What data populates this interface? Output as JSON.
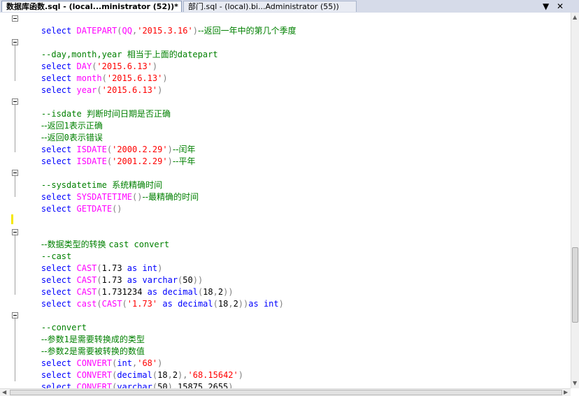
{
  "tabs": [
    {
      "label": "数据库函数.sql - (local...ministrator (52))*",
      "active": true
    },
    {
      "label": "部门.sql - (local).bi...Administrator (55))",
      "active": false
    }
  ],
  "tab_controls": {
    "dropdown": "▼",
    "close": "✕"
  },
  "code": {
    "l1": {
      "a": "select",
      "b": "DATEPART",
      "c": "(",
      "d": "QQ",
      "e": ",",
      "f": "'2015.3.16'",
      "g": ")",
      "h": "--返回一年中的第几个季度"
    },
    "l3": {
      "a": "--day,month,year ",
      "b": "相当于上面的",
      "c": "datepart"
    },
    "l4": {
      "a": "select",
      "b": "DAY",
      "c": "(",
      "d": "'2015.6.13'",
      "e": ")"
    },
    "l5": {
      "a": "select",
      "b": "month",
      "c": "(",
      "d": "'2015.6.13'",
      "e": ")"
    },
    "l6": {
      "a": "select",
      "b": "year",
      "c": "(",
      "d": "'2015.6.13'",
      "e": ")"
    },
    "l8": {
      "a": "--isdate ",
      "b": "判断时间日期是否正确"
    },
    "l9": {
      "a": "--返回",
      "b": "1",
      "c": "表示正确"
    },
    "l10": {
      "a": "--返回",
      "b": "0",
      "c": "表示错误"
    },
    "l11": {
      "a": "select",
      "b": "ISDATE",
      "c": "(",
      "d": "'2000.2.29'",
      "e": ")",
      "f": "--闰年"
    },
    "l12": {
      "a": "select",
      "b": "ISDATE",
      "c": "(",
      "d": "'2001.2.29'",
      "e": ")",
      "f": "--平年"
    },
    "l14": {
      "a": "--sysdatetime ",
      "b": "系统精确时间"
    },
    "l15": {
      "a": "select",
      "b": "SYSDATETIME",
      "c": "()",
      "d": "--最精确的时间"
    },
    "l16": {
      "a": "select",
      "b": "GETDATE",
      "c": "()"
    },
    "l19": {
      "a": "--数据类型的转换 ",
      "b": "cast convert"
    },
    "l20": {
      "a": "--cast"
    },
    "l21": {
      "a": "select",
      "b": "CAST",
      "c": "(",
      "d": "1.73",
      "e": "as",
      "f": "int",
      "g": ")"
    },
    "l22": {
      "a": "select",
      "b": "CAST",
      "c": "(",
      "d": "1.73",
      "e": "as",
      "f": "varchar",
      "g": "(",
      "h": "50",
      "i": "))"
    },
    "l23": {
      "a": "select",
      "b": "CAST",
      "c": "(",
      "d": "1.731234",
      "e": "as",
      "f": "decimal",
      "g": "(",
      "h": "18",
      "i": ",",
      "j": "2",
      "k": "))"
    },
    "l24": {
      "a": "select",
      "b": "cast",
      "c": "(",
      "d": "CAST",
      "e": "(",
      "f": "'1.73'",
      "g": "as",
      "h": "decimal",
      "i": "(",
      "j": "18",
      "k": ",",
      "l": "2",
      "m": "))",
      "n": "as",
      "o": "int",
      "p": ")"
    },
    "l26": {
      "a": "--convert"
    },
    "l27": {
      "a": "--参数",
      "b": "1",
      "c": "是需要转换成的类型"
    },
    "l28": {
      "a": "--参数",
      "b": "2",
      "c": "是需要被转换的数值"
    },
    "l29": {
      "a": "select",
      "b": "CONVERT",
      "c": "(",
      "d": "int",
      "e": ",",
      "f": "'68'",
      "g": ")"
    },
    "l30": {
      "a": "select",
      "b": "CONVERT",
      "c": "(",
      "d": "decimal",
      "e": "(",
      "f": "18",
      "g": ",",
      "h": "2",
      "i": "),",
      "j": "'68.15642'",
      "k": ")"
    },
    "l31": {
      "a": "select",
      "b": "CONVERT",
      "c": "(",
      "d": "varchar",
      "e": "(",
      "f": "50",
      "g": "),",
      "h": "15875.2655",
      "i": ")"
    }
  },
  "colors": {
    "keyword": "#0000ff",
    "function": "#ff00ff",
    "string": "#ff0000",
    "comment": "#008000",
    "operator": "#808080"
  }
}
